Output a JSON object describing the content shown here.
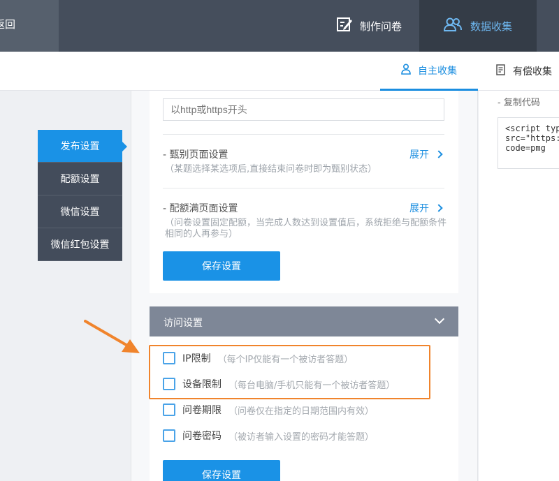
{
  "topbar": {
    "back_label": "返回",
    "make_label": "制作问卷",
    "data_label": "数据收集",
    "make_icon": "edit-icon",
    "data_icon": "users-icon"
  },
  "subtabs": {
    "self_label": "自主收集",
    "paid_label": "有偿收集",
    "self_icon": "person-icon",
    "paid_icon": "document-icon"
  },
  "leftmenu": {
    "items": [
      {
        "label": "发布设置",
        "active": true
      },
      {
        "label": "配额设置",
        "active": false
      },
      {
        "label": "微信设置",
        "active": false
      },
      {
        "label": "微信红包设置",
        "active": false
      }
    ]
  },
  "publish": {
    "url_placeholder": "以http或https开头",
    "screen_title": "- 甄别页面设置",
    "screen_desc": "（某题选择某选项后,直接结束问卷时即为甄别状态）",
    "quota_title": "- 配额满页面设置",
    "quota_desc": "（问卷设置固定配额，当完成人数达到设置值后，系统拒绝与配额条件相同的人再参与）",
    "expand_label": "展开",
    "save_label": "保存设置"
  },
  "access": {
    "title": "访问设置",
    "options": [
      {
        "label": "IP限制",
        "desc": "（每个IP仅能有一个被访者答题）",
        "checked": false
      },
      {
        "label": "设备限制",
        "desc": "（每台电脑/手机只能有一个被访者答题）",
        "checked": false
      },
      {
        "label": "问卷期限",
        "desc": "（问卷仅在指定的日期范围内有效）",
        "checked": false
      },
      {
        "label": "问卷密码",
        "desc": "（被访者输入设置的密码才能答题）",
        "checked": false
      }
    ],
    "save_label": "保存设置"
  },
  "right": {
    "copy_label": "- 复制代码",
    "code_text": "<script type\nsrc=\"https:/\ncode=pmg"
  },
  "colors": {
    "accent": "#1a92e6",
    "highlight": "#f0842c",
    "topbar": "#454e5c"
  }
}
